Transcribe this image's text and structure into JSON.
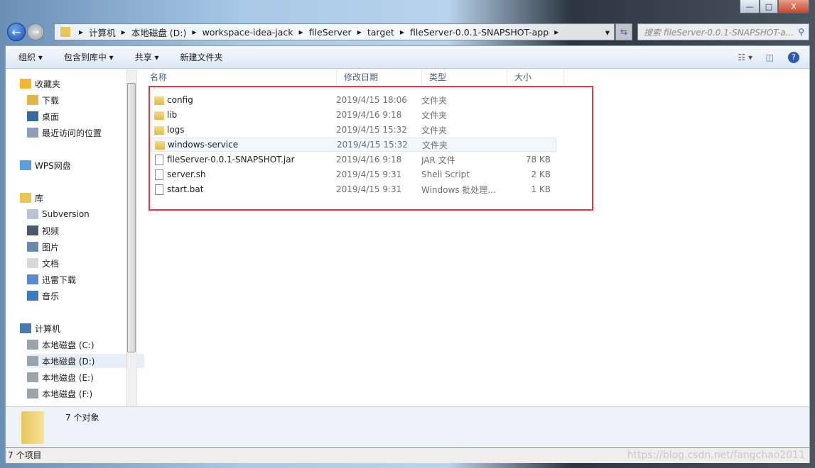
{
  "window": {
    "minimize": "—",
    "maximize": "□",
    "close": "X"
  },
  "address": {
    "crumbs": [
      "计算机",
      "本地磁盘 (D:)",
      "workspace-idea-jack",
      "fileServer",
      "target",
      "fileServer-0.0.1-SNAPSHOT-app"
    ]
  },
  "search": {
    "placeholder": "搜索 fileServer-0.0.1-SNAPSHOT-a..."
  },
  "toolbar": {
    "organize": "组织 ▾",
    "include_library": "包含到库中 ▾",
    "share": "共享 ▾",
    "new_folder": "新建文件夹"
  },
  "sidebar": {
    "favorites": "收藏夹",
    "fav_items": [
      "下载",
      "桌面",
      "最近访问的位置"
    ],
    "wps": "WPS网盘",
    "libraries": "库",
    "lib_items": [
      "Subversion",
      "视频",
      "图片",
      "文档",
      "迅雷下载",
      "音乐"
    ],
    "computer": "计算机",
    "drives": [
      "本地磁盘 (C:)",
      "本地磁盘 (D:)",
      "本地磁盘 (E:)",
      "本地磁盘 (F:)"
    ]
  },
  "columns": {
    "name": "名称",
    "date": "修改日期",
    "type": "类型",
    "size": "大小"
  },
  "files": [
    {
      "name": "config",
      "date": "2019/4/15 18:06",
      "type": "文件夹",
      "size": "",
      "kind": "folder"
    },
    {
      "name": "lib",
      "date": "2019/4/16 9:18",
      "type": "文件夹",
      "size": "",
      "kind": "folder"
    },
    {
      "name": "logs",
      "date": "2019/4/15 15:32",
      "type": "文件夹",
      "size": "",
      "kind": "folder"
    },
    {
      "name": "windows-service",
      "date": "2019/4/15 15:32",
      "type": "文件夹",
      "size": "",
      "kind": "folder"
    },
    {
      "name": "fileServer-0.0.1-SNAPSHOT.jar",
      "date": "2019/4/16 9:18",
      "type": "JAR 文件",
      "size": "78 KB",
      "kind": "file"
    },
    {
      "name": "server.sh",
      "date": "2019/4/15 9:31",
      "type": "Shell Script",
      "size": "2 KB",
      "kind": "file"
    },
    {
      "name": "start.bat",
      "date": "2019/4/15 9:31",
      "type": "Windows 批处理...",
      "size": "1 KB",
      "kind": "file"
    }
  ],
  "details": {
    "summary": "7 个对象"
  },
  "status": {
    "count": "7 个项目"
  },
  "watermark": "https://blog.csdn.net/fangchao2011",
  "colors": {
    "highlight_box": "#e8383d",
    "selected_row": "#f2f7fd"
  }
}
